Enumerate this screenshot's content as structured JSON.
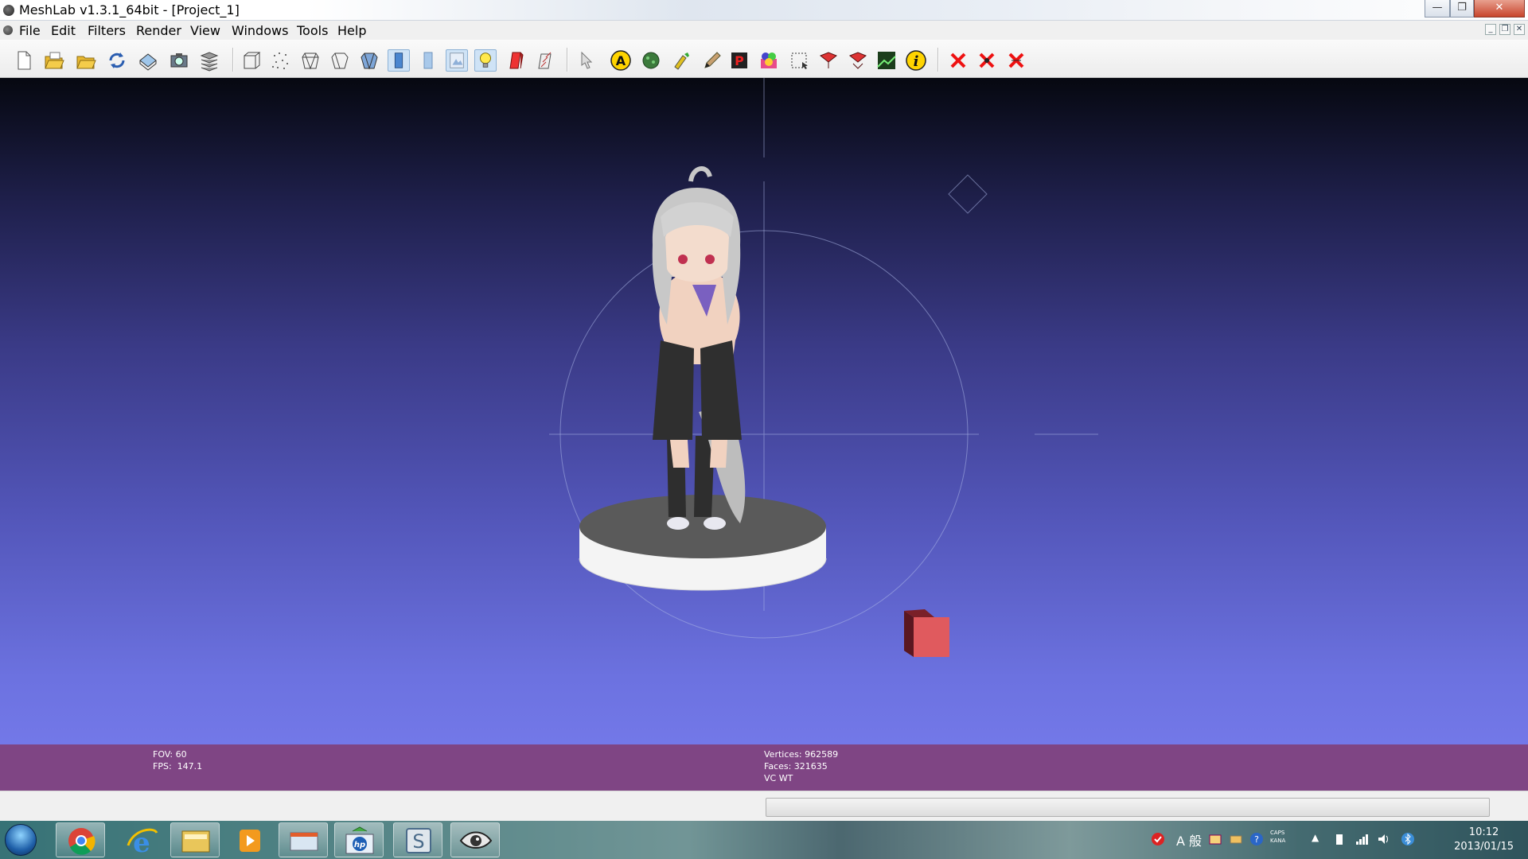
{
  "window": {
    "title": "MeshLab v1.3.1_64bit - [Project_1]",
    "minimize_glyph": "—",
    "maximize_glyph": "❐",
    "close_glyph": "✕"
  },
  "menu": {
    "items": [
      "File",
      "Edit",
      "Filters",
      "Render",
      "View",
      "Windows",
      "Tools",
      "Help"
    ]
  },
  "toolbar": {
    "icons": [
      "new-document-icon",
      "open-project-icon",
      "open-mesh-icon",
      "reload-icon",
      "save-icon",
      "snapshot-icon",
      "layers-icon",
      "bounding-box-icon",
      "points-icon",
      "wireframe-icon",
      "hidden-lines-icon",
      "flat-lines-icon",
      "flat-shading-icon",
      "smooth-shading-icon",
      "texture-icon",
      "light-bulb-icon",
      "color-icon",
      "normals-icon",
      "manipulator-icon",
      "annotation-icon",
      "paint-icon",
      "color-brush-icon",
      "pencil-icon",
      "pick-points-icon",
      "vertex-color-icon",
      "select-faces-icon",
      "select-region-icon",
      "select-connected-icon",
      "raster-align-icon",
      "info-icon",
      "delete-selected-icon",
      "delete-vertices-icon",
      "delete-faces-icon"
    ]
  },
  "viewport": {
    "fov": "FOV: 60",
    "fps": "FPS:  147.1",
    "vertices": "Vertices: 962589",
    "faces": "Faces: 321635",
    "mode": "VC WT"
  },
  "taskbar": {
    "apps": [
      "chrome-icon",
      "internet-explorer-icon",
      "file-explorer-icon",
      "media-player-icon",
      "hp-icon",
      "s-app-icon",
      "meshlab-eye-icon"
    ],
    "ime_text": "A 般",
    "caps": "CAPS",
    "kana": "KANA",
    "time": "10:12",
    "date": "2013/01/15"
  },
  "colors": {
    "info_bar": "#7f4584",
    "viewport_top": "#060810",
    "viewport_bottom": "#7378e8"
  }
}
